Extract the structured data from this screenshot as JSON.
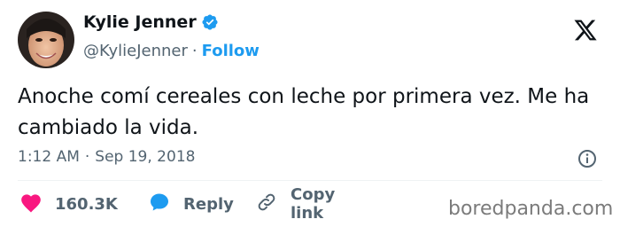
{
  "author": {
    "name": "Kylie Jenner",
    "handle": "@KylieJenner",
    "separator": "·",
    "follow_label": "Follow"
  },
  "tweet": {
    "text": "Anoche comí cereales con leche por primera vez. Me ha cambiado la vida.",
    "time": "1:12 AM",
    "separator": "·",
    "date": "Sep 19, 2018"
  },
  "actions": {
    "like_count": "160.3K",
    "reply_label": "Reply",
    "copy_label": "Copy link"
  },
  "watermark": "boredpanda.com",
  "colors": {
    "accent": "#1d9bf0",
    "like": "#f91880",
    "text": "#0f1419",
    "muted": "#536471"
  },
  "icons": [
    "verified-badge-icon",
    "x-logo-icon",
    "info-icon",
    "heart-icon",
    "reply-bubble-icon",
    "link-icon"
  ]
}
